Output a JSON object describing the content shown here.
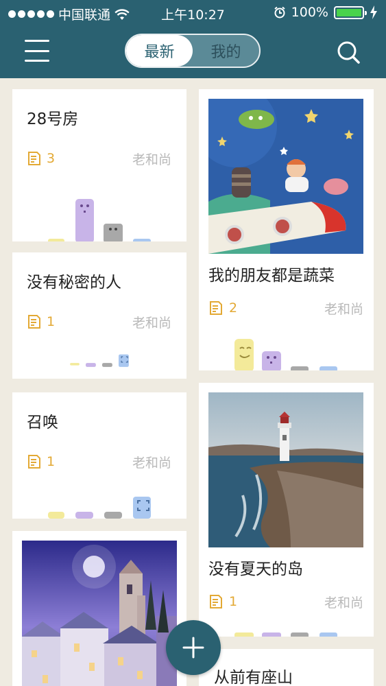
{
  "status_bar": {
    "carrier": "中国联通",
    "time": "上午10:27",
    "battery": "100%",
    "battery_level": 1.0
  },
  "nav": {
    "tabs": [
      {
        "label": "最新",
        "active": true
      },
      {
        "label": "我的",
        "active": false
      }
    ]
  },
  "cards": {
    "c1": {
      "title": "28号房",
      "count": "3",
      "author": "老和尚"
    },
    "c2": {
      "title": "没有秘密的人",
      "count": "1",
      "author": "老和尚"
    },
    "c3": {
      "title": "召唤",
      "count": "1",
      "author": "老和尚"
    },
    "c5": {
      "title": "我的朋友都是蔬菜",
      "count": "2",
      "author": "老和尚"
    },
    "c6": {
      "title": "没有夏天的岛",
      "count": "1",
      "author": "老和尚"
    },
    "c7": {
      "title": "从前有座山"
    }
  },
  "colors": {
    "accent": "#2a6171",
    "count": "#e3a934",
    "author": "#b9b9b9",
    "background": "#efebe1"
  }
}
